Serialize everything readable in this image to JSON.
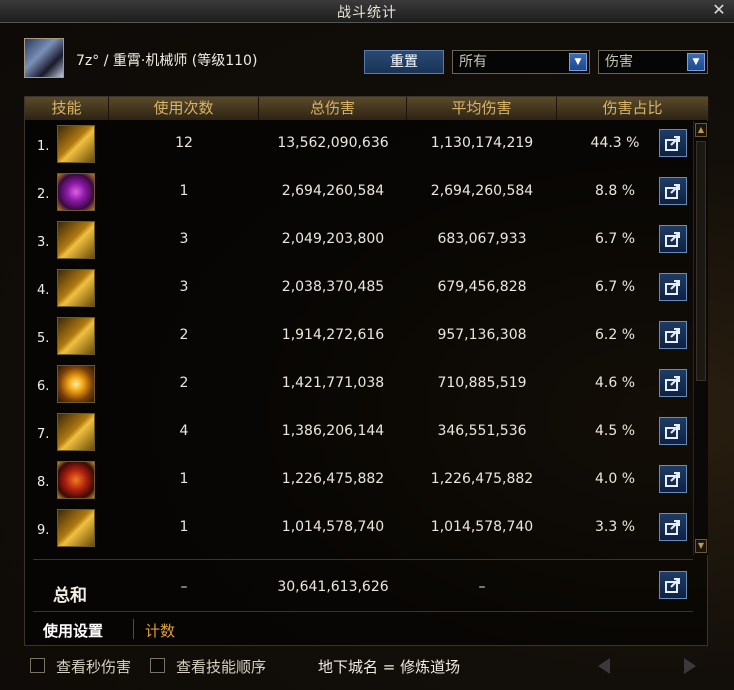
{
  "window": {
    "title": "战斗统计",
    "close_symbol": "✕"
  },
  "header": {
    "character_name": "7z° / 重霄·机械师 (等级110)",
    "reset_label": "重置",
    "filter_select": "所有",
    "metric_select": "伤害"
  },
  "table": {
    "columns": [
      "技能",
      "使用次数",
      "总伤害",
      "平均伤害",
      "伤害占比"
    ],
    "rows": [
      {
        "num": "1.",
        "icon": "gold-cannon-skill-icon",
        "uses": "12",
        "total": "13,562,090,636",
        "avg": "1,130,174,219",
        "share": "44.3 %"
      },
      {
        "num": "2.",
        "icon": "purple-hexagon-skill-icon",
        "uses": "1",
        "total": "2,694,260,584",
        "avg": "2,694,260,584",
        "share": "8.8 %"
      },
      {
        "num": "3.",
        "icon": "missile-strike-skill-icon",
        "uses": "3",
        "total": "2,049,203,800",
        "avg": "683,067,933",
        "share": "6.7 %"
      },
      {
        "num": "4.",
        "icon": "g3-robot-skill-icon",
        "uses": "3",
        "total": "2,038,370,485",
        "avg": "679,456,828",
        "share": "6.7 %"
      },
      {
        "num": "5.",
        "icon": "rocket-barrage-skill-icon",
        "uses": "2",
        "total": "1,914,272,616",
        "avg": "957,136,308",
        "share": "6.2 %"
      },
      {
        "num": "6.",
        "icon": "explosion-burst-skill-icon",
        "uses": "2",
        "total": "1,421,771,038",
        "avg": "710,885,519",
        "share": "4.6 %"
      },
      {
        "num": "7.",
        "icon": "g2-gear-skill-icon",
        "uses": "4",
        "total": "1,386,206,144",
        "avg": "346,551,536",
        "share": "4.5 %"
      },
      {
        "num": "8.",
        "icon": "flame-mech-skill-icon",
        "uses": "1",
        "total": "1,226,475,882",
        "avg": "1,226,475,882",
        "share": "4.0 %"
      },
      {
        "num": "9.",
        "icon": "twin-cannon-skill-icon",
        "uses": "1",
        "total": "1,014,578,740",
        "avg": "1,014,578,740",
        "share": "3.3 %"
      }
    ],
    "total": {
      "label": "总和",
      "uses": "–",
      "total": "30,641,613,626",
      "avg": "–"
    }
  },
  "tabs": {
    "active": "使用设置",
    "inactive": "计数"
  },
  "footer": {
    "check_dps_label": "查看秒伤害",
    "check_order_label": "查看技能顺序",
    "dungeon_text": "地下城名 = 修炼道场"
  }
}
